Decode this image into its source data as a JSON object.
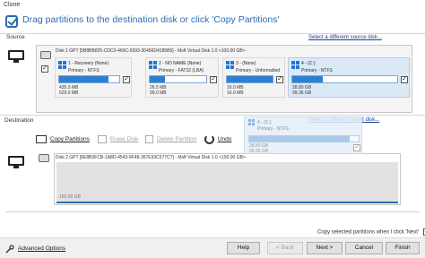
{
  "window": {
    "title": "Clone"
  },
  "header": {
    "title": "Drag partitions to the destination disk or click 'Copy Partitions'"
  },
  "source": {
    "label": "Source",
    "select_link": "Select a different source disk...",
    "disk_header": "Disk 1 GPT [5B8BB825-CDC0-469C-9393-30456D4185B5] - Msft     Virtual Disk     1.0  <100.00 GB>",
    "partitions": [
      {
        "name": "1 - Recovery (None)",
        "type": "Primary - NTFS",
        "used": "435.0 MB",
        "total": "529.0 MB",
        "fill": 0.82,
        "selected": false
      },
      {
        "name": "2 - NO NAME (None)",
        "type": "Primary - FAT32 (LBA)",
        "used": "26.5 MB",
        "total": "99.0 MB",
        "fill": 0.27,
        "selected": false
      },
      {
        "name": "3 - (None)",
        "type": "Primary - Unformatted",
        "used": "16.0 MB",
        "total": "16.0 MB",
        "fill": 1.0,
        "selected": false
      },
      {
        "name": "4 - (C:)",
        "type": "Primary - NTFS",
        "used": "28.80 GB",
        "total": "99.36 GB",
        "fill": 0.29,
        "selected": true
      }
    ]
  },
  "destination": {
    "label": "Destination",
    "select_link": "Select a different target disk...",
    "toolbar": {
      "copy": "Copy Partitions",
      "erase": "Erase Disk",
      "delete": "Delete Partition",
      "undo": "Undo"
    },
    "disk_header": "Disk 2 GPT [6E8B3FCB-1A8D-4543-9F48-357E93C577C7] - Msft     Virtual Disk     1.0  <150.00 GB>",
    "unallocated": "150.00 GB",
    "ghost": {
      "name": "4 - (C:)",
      "type": "Primary - NTFS",
      "v1": "28.80 GB",
      "v2": "99.36 GB"
    }
  },
  "bottom_checkbox": {
    "label": "Copy selected partitions when I click 'Next'",
    "checked": true
  },
  "footer": {
    "advanced": "Advanced Options",
    "help": "Help",
    "back": "< Back",
    "next": "Next >",
    "cancel": "Cancel",
    "finish": "Finish"
  },
  "colors": {
    "accent": "#2b6cb0",
    "bar_fill": "#2f7fd1",
    "windows_icon": "#1e78d6"
  }
}
